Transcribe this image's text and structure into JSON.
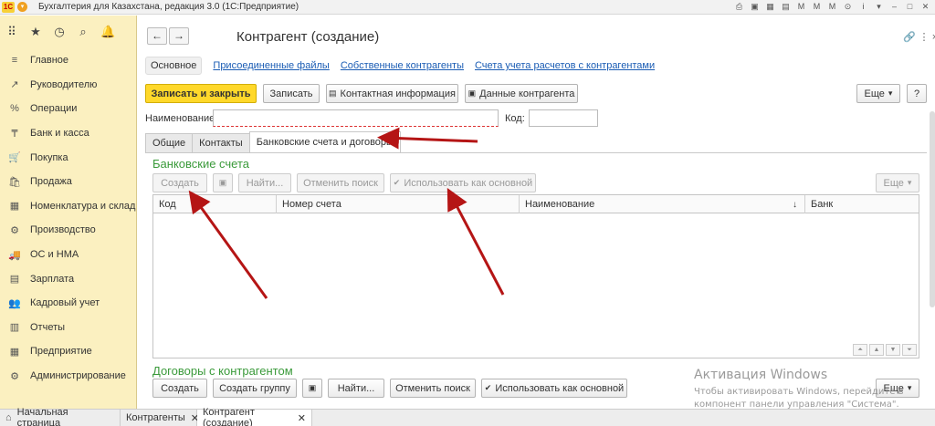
{
  "app": {
    "logo": "1С",
    "title": "Бухгалтерия для Казахстана, редакция 3.0  (1С:Предприятие)"
  },
  "sidebar": {
    "items": [
      {
        "label": "Главное",
        "icon": "≡"
      },
      {
        "label": "Руководителю",
        "icon": "↗"
      },
      {
        "label": "Операции",
        "icon": "%"
      },
      {
        "label": "Банк и касса",
        "icon": "₸"
      },
      {
        "label": "Покупка",
        "icon": "🛒"
      },
      {
        "label": "Продажа",
        "icon": "🛍"
      },
      {
        "label": "Номенклатура и склад",
        "icon": "▦"
      },
      {
        "label": "Производство",
        "icon": "⚙"
      },
      {
        "label": "ОС и НМА",
        "icon": "🚚"
      },
      {
        "label": "Зарплата",
        "icon": "▤"
      },
      {
        "label": "Кадровый учет",
        "icon": "👥"
      },
      {
        "label": "Отчеты",
        "icon": "▥"
      },
      {
        "label": "Предприятие",
        "icon": "▦"
      },
      {
        "label": "Администрирование",
        "icon": "⚙"
      }
    ]
  },
  "form": {
    "title": "Контрагент (создание)",
    "link_tabs": [
      "Основное",
      "Присоединенные файлы",
      "Собственные контрагенты",
      "Счета учета расчетов с контрагентами"
    ],
    "toolbar": {
      "save_close": "Записать и закрыть",
      "save": "Записать",
      "contact_info": "Контактная информация",
      "counterparty_data": "Данные контрагента",
      "more": "Еще",
      "help": "?"
    },
    "name_label": "Наименование:",
    "name_value": "",
    "code_label": "Код:",
    "code_value": "",
    "tabs": [
      "Общие",
      "Контакты",
      "Банковские счета и договоры"
    ],
    "bank": {
      "title": "Банковские счета",
      "create": "Создать",
      "find": "Найти...",
      "cancel_search": "Отменить поиск",
      "use_main": "Использовать как основной",
      "more": "Еще",
      "columns": [
        "Код",
        "Номер счета",
        "Наименование",
        "Банк"
      ],
      "rows": []
    },
    "contracts": {
      "title": "Договоры с контрагентом",
      "create": "Создать",
      "create_group": "Создать группу",
      "find": "Найти...",
      "cancel_search": "Отменить поиск",
      "use_main": "Использовать как основной",
      "more": "Еще"
    }
  },
  "watermark": {
    "line1": "Активация Windows",
    "line2": "Чтобы активировать Windows, перейдите в",
    "line3": "компонент панели управления \"Система\"."
  },
  "bottom_tabs": [
    {
      "label": "Начальная страница"
    },
    {
      "label": "Контрагенты"
    },
    {
      "label": "Контрагент (создание)"
    }
  ],
  "colors": {
    "accent": "#ffd82a",
    "sidebar": "#fbf0c0",
    "section_title": "#3a9a3a",
    "link": "#1a5cb4",
    "annotation_arrow": "#b51515"
  }
}
